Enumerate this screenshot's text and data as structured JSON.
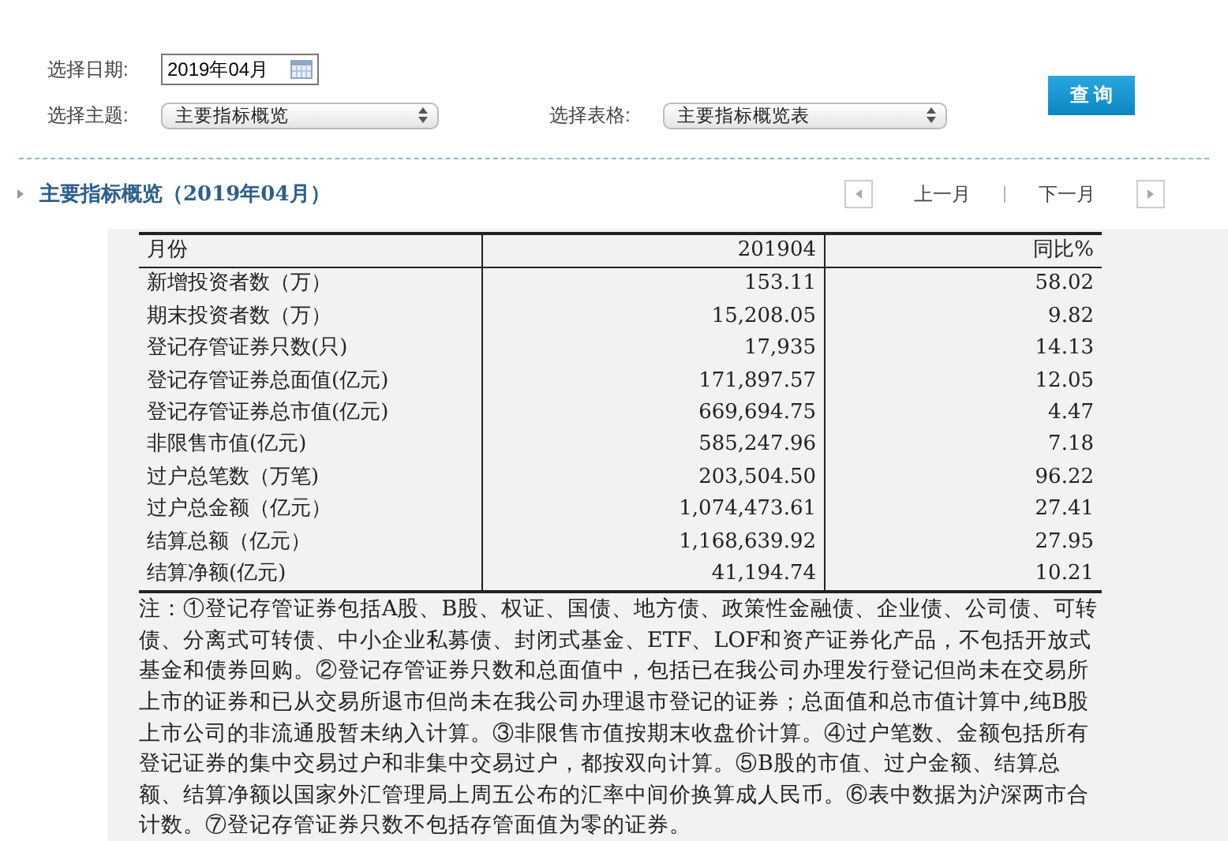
{
  "filters": {
    "date_label": "选择日期:",
    "date_value": "2019年04月",
    "topic_label": "选择主题:",
    "topic_value": "主要指标概览",
    "table_label": "选择表格:",
    "table_value": "主要指标概览表",
    "query_button": "查 询"
  },
  "section": {
    "title": "主要指标概览（2019年04月）",
    "prev": "上一月",
    "separator": "|",
    "next": "下一月"
  },
  "table": {
    "columns": [
      "月份",
      "201904",
      "同比%"
    ],
    "rows": [
      [
        "新增投资者数（万）",
        "153.11",
        "58.02"
      ],
      [
        "期末投资者数（万）",
        "15,208.05",
        "9.82"
      ],
      [
        "登记存管证券只数(只)",
        "17,935",
        "14.13"
      ],
      [
        "登记存管证券总面值(亿元)",
        "171,897.57",
        "12.05"
      ],
      [
        "登记存管证券总市值(亿元)",
        "669,694.75",
        "4.47"
      ],
      [
        "非限售市值(亿元)",
        "585,247.96",
        "7.18"
      ],
      [
        "过户总笔数（万笔)",
        "203,504.50",
        "96.22"
      ],
      [
        "过户总金额（亿元）",
        "1,074,473.61",
        "27.41"
      ],
      [
        "结算总额（亿元）",
        "1,168,639.92",
        "27.95"
      ],
      [
        "结算净额(亿元)",
        "41,194.74",
        "10.21"
      ]
    ],
    "note": "注：①登记存管证券包括A股、B股、权证、国债、地方债、政策性金融债、企业债、公司债、可转债、分离式可转债、中小企业私募债、封闭式基金、ETF、LOF和资产证券化产品，不包括开放式基金和债券回购。②登记存管证券只数和总面值中，包括已在我公司办理发行登记但尚未在交易所上市的证券和已从交易所退市但尚未在我公司办理退市登记的证券；总面值和总市值计算中,纯B股上市公司的非流通股暂未纳入计算。③非限售市值按期末收盘价计算。④过户笔数、金额包括所有登记证券的集中交易过户和非集中交易过户，都按双向计算。⑤B股的市值、过户金额、结算总额、结算净额以国家外汇管理局上周五公布的汇率中间价换算成人民币。⑥表中数据为沪深两市合计数。⑦登记存管证券只数不包括存管面值为零的证券。"
  }
}
